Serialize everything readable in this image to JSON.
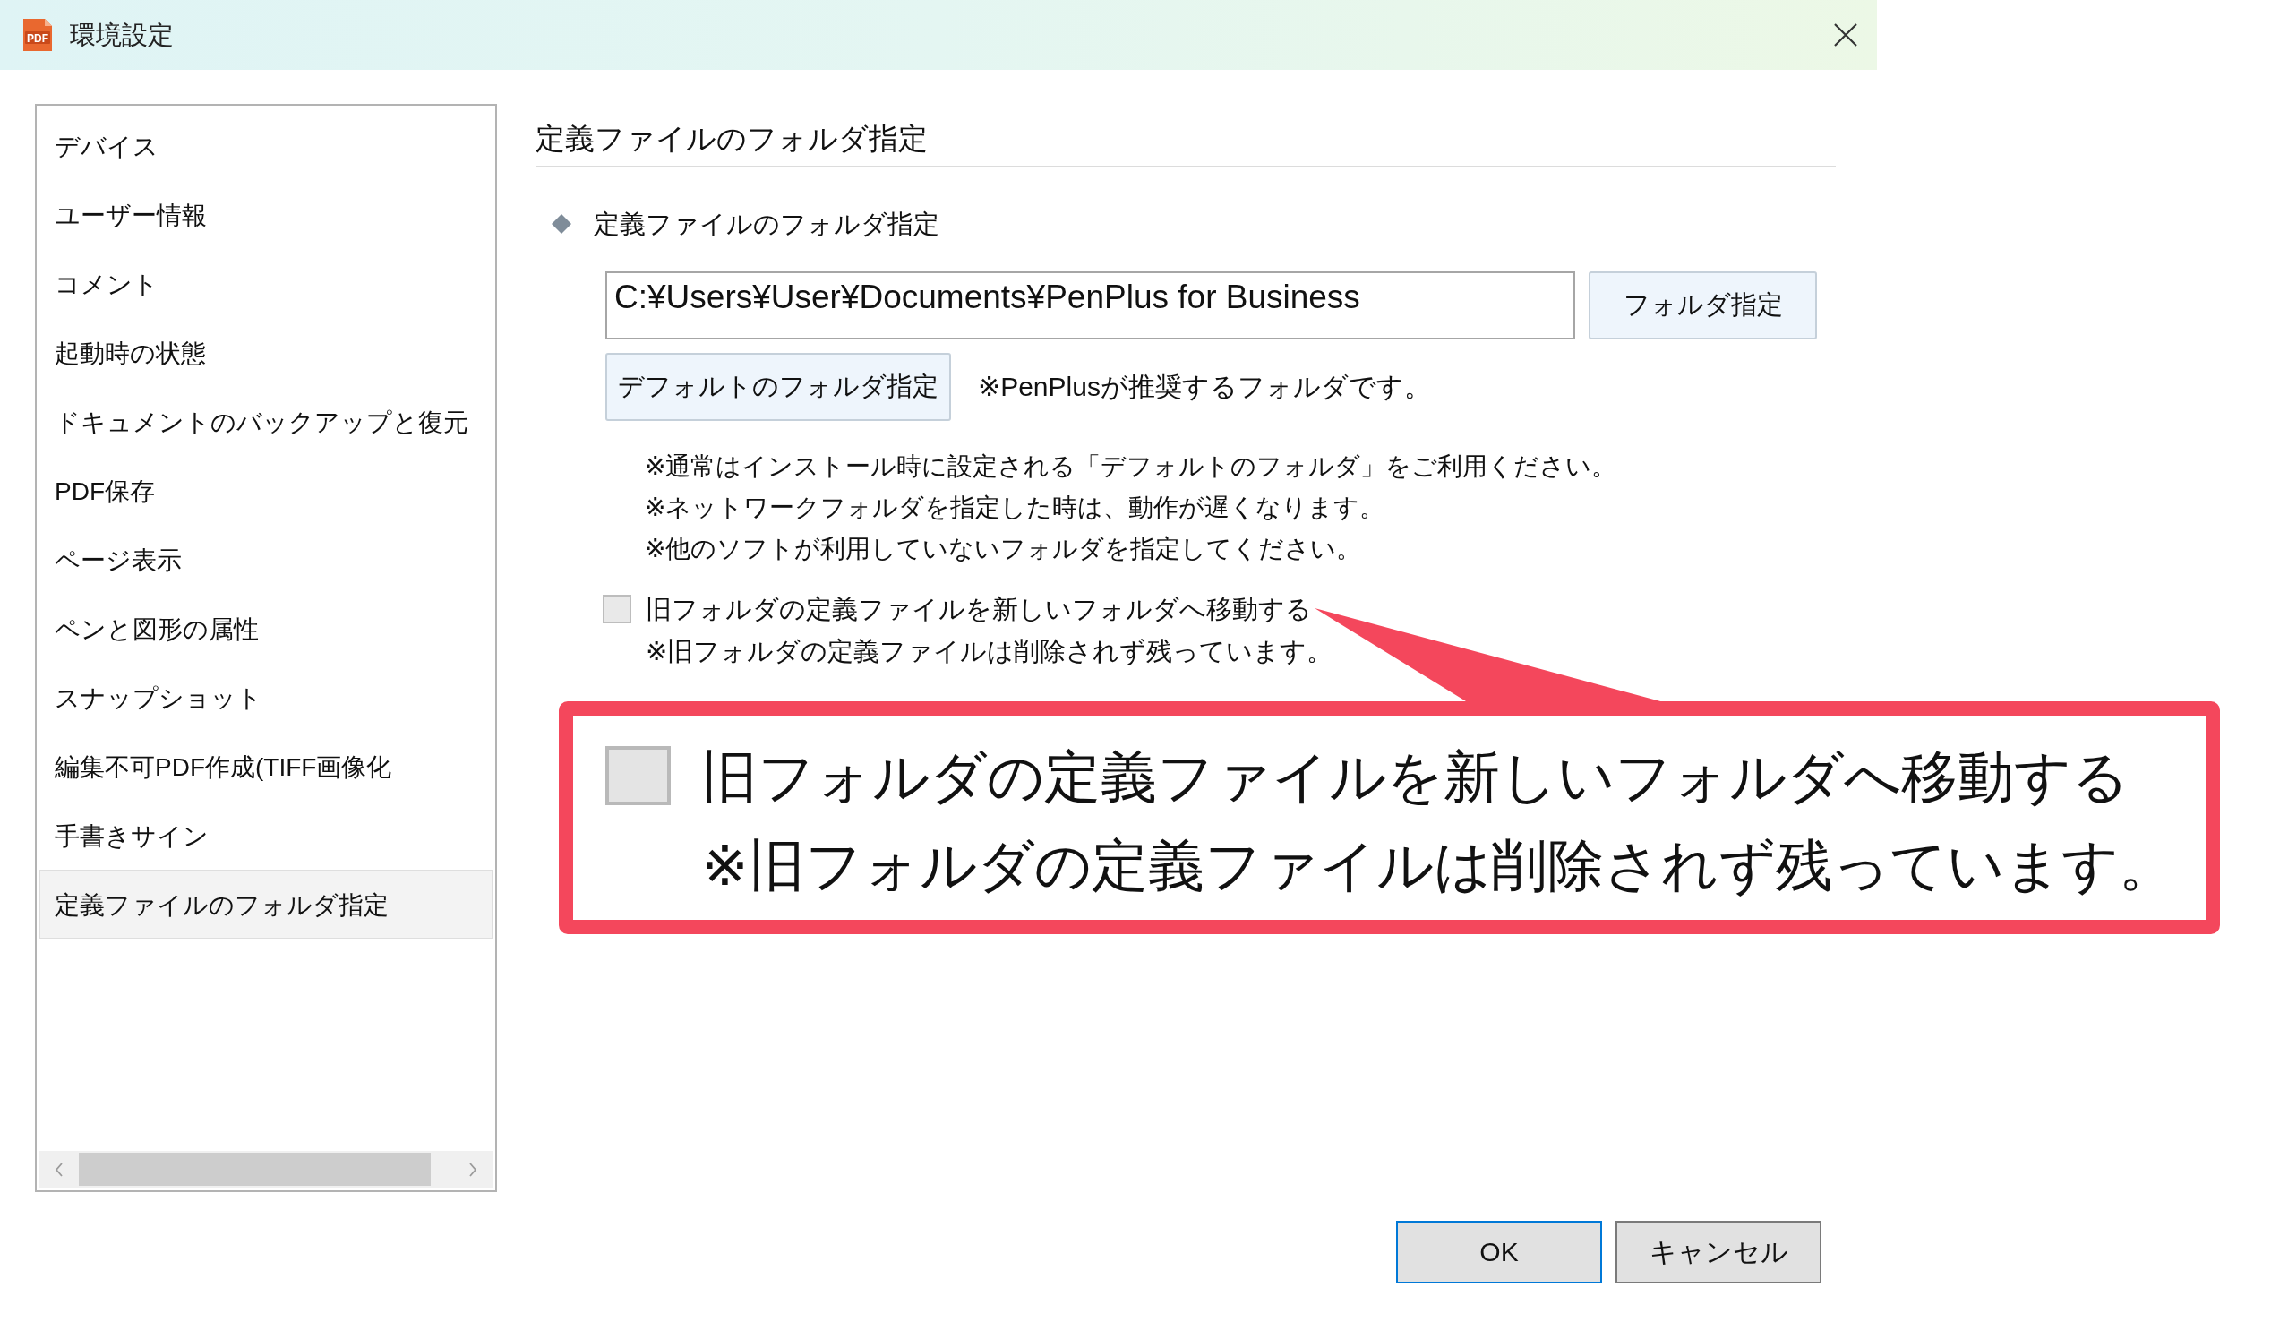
{
  "window": {
    "title": "環境設定",
    "icon_label": "PDF"
  },
  "sidebar": {
    "items": [
      {
        "label": "デバイス",
        "selected": false
      },
      {
        "label": "ユーザー情報",
        "selected": false
      },
      {
        "label": "コメント",
        "selected": false
      },
      {
        "label": "起動時の状態",
        "selected": false
      },
      {
        "label": "ドキュメントのバックアップと復元",
        "selected": false
      },
      {
        "label": "PDF保存",
        "selected": false
      },
      {
        "label": "ページ表示",
        "selected": false
      },
      {
        "label": "ペンと図形の属性",
        "selected": false
      },
      {
        "label": "スナップショット",
        "selected": false
      },
      {
        "label": "編集不可PDF作成(TIFF画像化",
        "selected": false
      },
      {
        "label": "手書きサイン",
        "selected": false
      },
      {
        "label": "定義ファイルのフォルダ指定",
        "selected": true
      }
    ]
  },
  "panel": {
    "heading": "定義ファイルのフォルダ指定",
    "section_label": "定義ファイルのフォルダ指定",
    "folder_path": {
      "value": "C:¥Users¥User¥Documents¥PenPlus for Business"
    },
    "browse_button": "フォルダ指定",
    "default_button": "デフォルトのフォルダ指定",
    "default_note": "※PenPlusが推奨するフォルダです。",
    "notes": [
      "※通常はインストール時に設定される「デフォルトのフォルダ」をご利用ください。",
      "※ネットワークフォルダを指定した時は、動作が遅くなります。",
      "※他のソフトが利用していないフォルダを指定してください。"
    ],
    "move_option": {
      "label": "旧フォルダの定義ファイルを新しいフォルダへ移動する",
      "checked": false,
      "note": "※旧フォルダの定義ファイルは削除されず残っています。"
    }
  },
  "callout": {
    "checked": false,
    "lines": [
      "旧フォルダの定義ファイルを新しいフォルダへ移動する",
      "※旧フォルダの定義ファイルは削除されず残っています。"
    ]
  },
  "buttons": [
    {
      "label": "OK",
      "focused": true
    },
    {
      "label": "キャンセル",
      "focused": false
    }
  ]
}
